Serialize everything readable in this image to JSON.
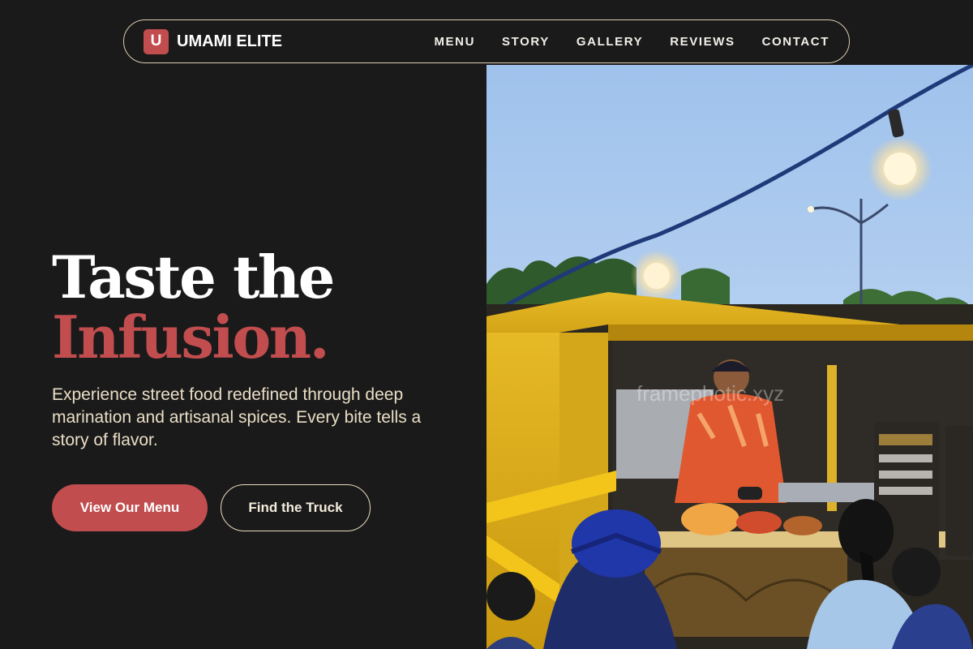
{
  "brand": {
    "badge": "U",
    "name": "UMAMI ELITE"
  },
  "nav": {
    "links": [
      "MENU",
      "STORY",
      "GALLERY",
      "REVIEWS",
      "CONTACT"
    ]
  },
  "hero": {
    "title_line1": "Taste the",
    "title_line2": "Infusion.",
    "subtitle": "Experience street food redefined through deep marination and artisanal spices. Every bite tells a story of flavor.",
    "primary_button": "View Our Menu",
    "secondary_button": "Find the Truck"
  },
  "image": {
    "description_icon": "food-truck-photo",
    "watermark": "framephotic.xyz"
  },
  "colors": {
    "background": "#1b1a1a",
    "accent": "#c24d4f",
    "cream": "#e9dec6"
  }
}
